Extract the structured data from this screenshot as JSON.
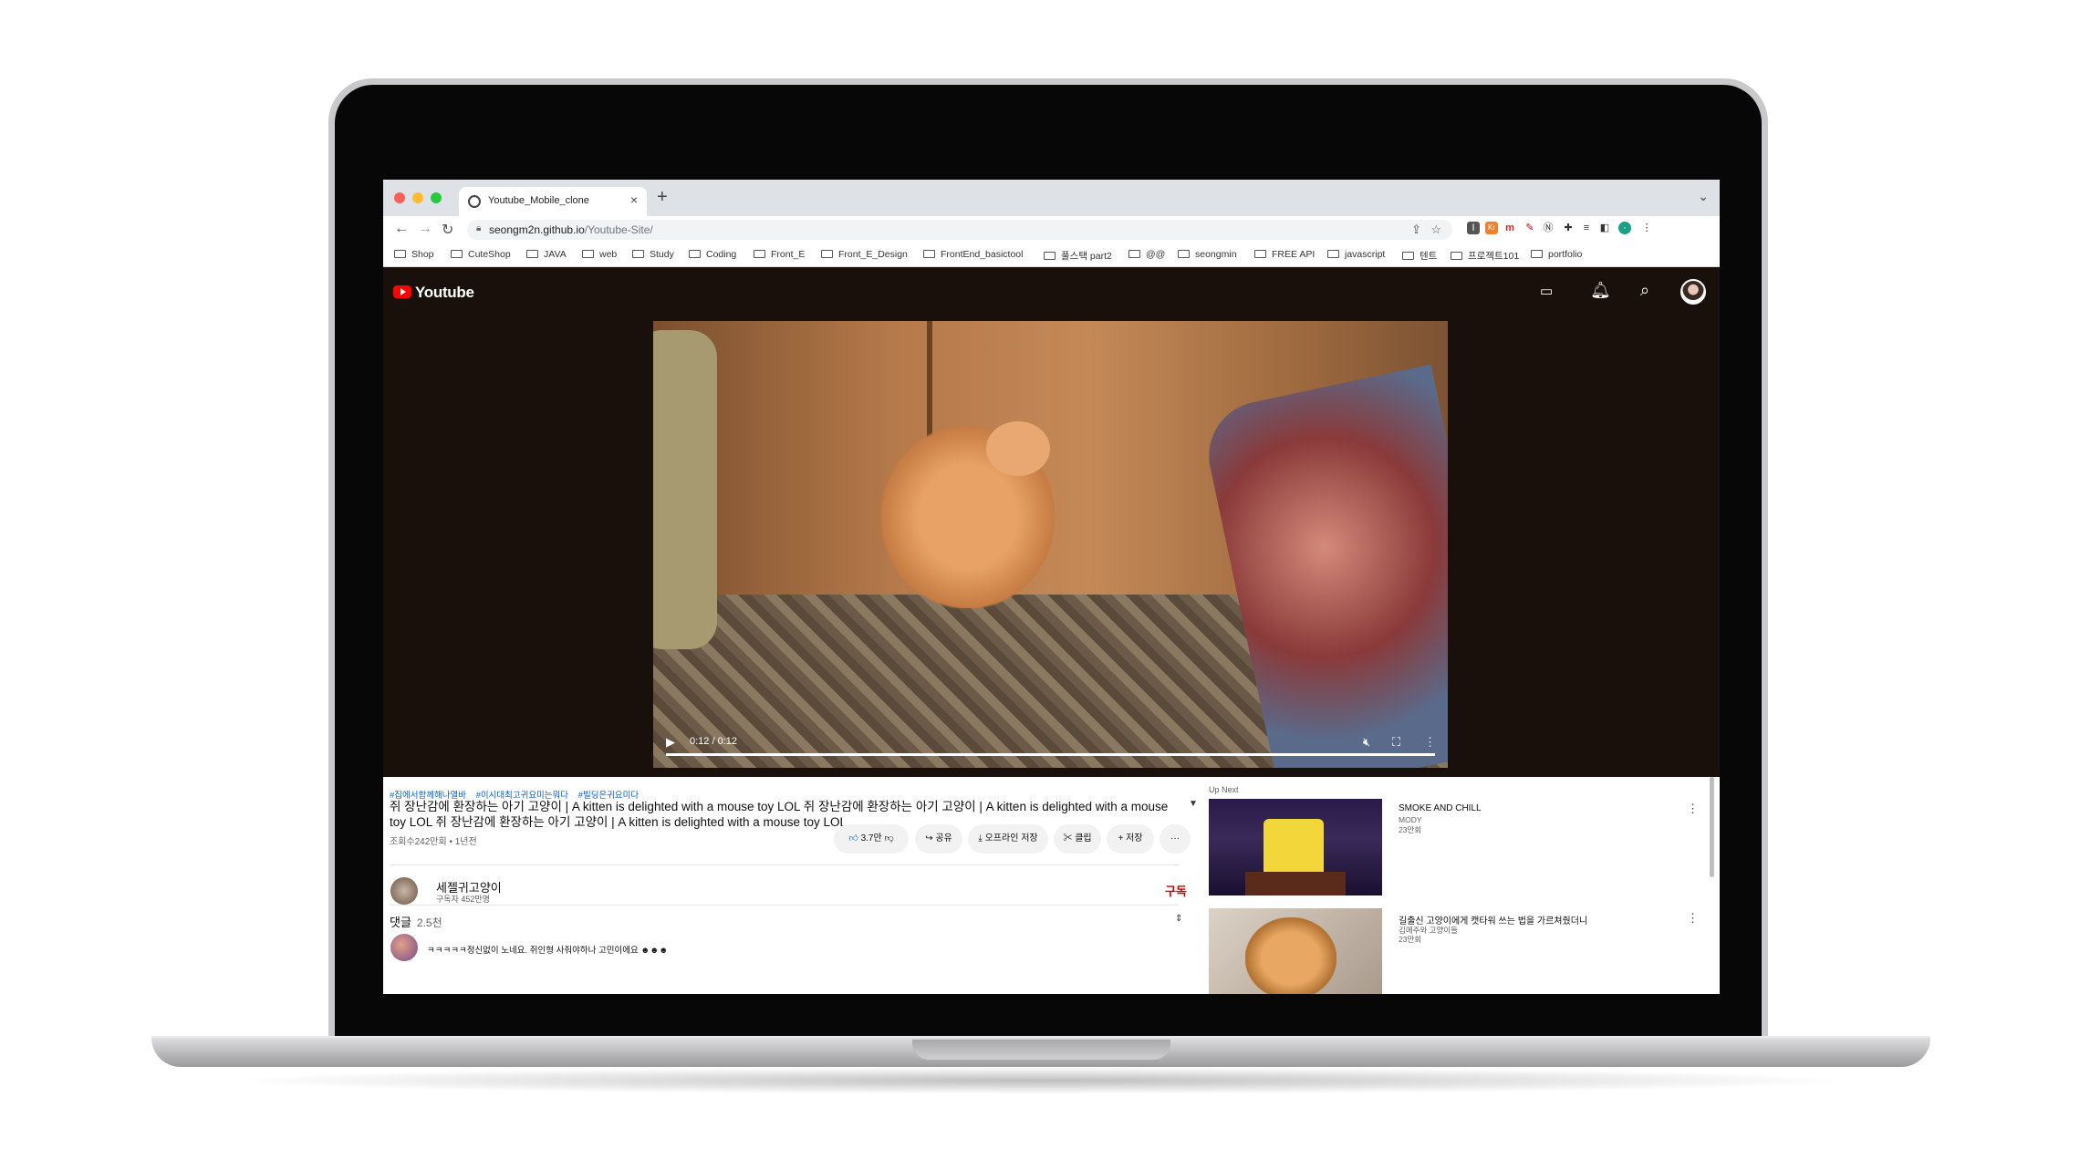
{
  "browser": {
    "tab_title": "Youtube_Mobile_clone",
    "url_host": "seongm2n.github.io",
    "url_path": "/Youtube-Site/",
    "bookmarks": [
      "Shop",
      "CuteShop",
      "JAVA",
      "web",
      "Study",
      "Coding",
      "Front_E",
      "Front_E_Design",
      "FrontEnd_basictool",
      "풀스택 part2",
      "@@",
      "seongmin",
      "FREE API",
      "javascript",
      "텐트",
      "프로젝트101",
      "portfolio"
    ],
    "traffic_colors": [
      "#ff5f57",
      "#febc2e",
      "#28c840"
    ]
  },
  "header": {
    "logo_text": "Youtube",
    "brand_color": "#ff0000"
  },
  "player": {
    "time": "0:12 / 0:12",
    "progress": 1.0
  },
  "video": {
    "tags": [
      "#집에서함께해나열바",
      "#이시대최고귀요미는뭐다",
      "#빌딩은귀요미다"
    ],
    "title": "쥐 장난감에 환장하는 아기 고양이 | A kitten is delighted with a mouse toy LOL 쥐 장난감에 환장하는 아기 고양이 | A kitten is delighted with a mouse toy LOL 쥐 장난감에 환장하는 아기 고양이 | A kitten is delighted with a mouse toy LOL",
    "meta": "조회수242만회 • 1년전",
    "actions": {
      "like": "3.7만",
      "share": "공유",
      "download": "오프라인 저장",
      "clip": "클립",
      "save": "저장",
      "more": "···"
    }
  },
  "channel": {
    "name": "세젤귀고양이",
    "subs": "구독자 452만명",
    "subscribe": "구독"
  },
  "comments": {
    "label": "댓글",
    "count": "2.5천",
    "first": "ㅋㅋㅋㅋㅋ정신없이 노네요. 쥐인형 사줘야하나 고민이에요 ☻☻☻"
  },
  "upnext": {
    "label": "Up Next",
    "items": [
      {
        "title": "SMOKE AND CHILL",
        "channel": "MODY",
        "views": "23만회"
      },
      {
        "title": "길출신 고양이에게 캣타워 쓰는 법을 가르쳐줬더니",
        "channel": "김메주와 고양이들",
        "views": "23만회"
      }
    ]
  }
}
